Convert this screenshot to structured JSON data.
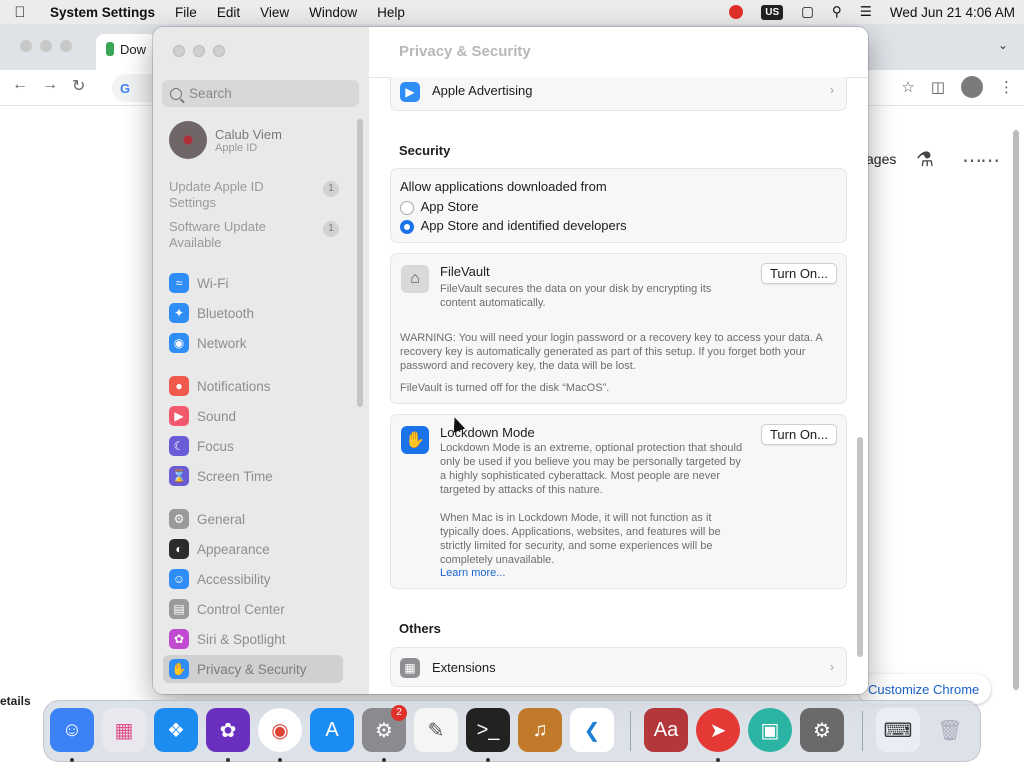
{
  "menubar": {
    "app_name": "System Settings",
    "menus": [
      "File",
      "Edit",
      "View",
      "Window",
      "Help"
    ],
    "input_source": "US",
    "datetime": "Wed Jun 21  4:06 AM"
  },
  "chrome": {
    "tab_title": "Dow",
    "images_link": "ages",
    "customize_button": "Customize Chrome",
    "left_strip_text": "etails"
  },
  "settings": {
    "search_placeholder": "Search",
    "profile": {
      "name": "Calub Viem",
      "subtitle": "Apple ID"
    },
    "updates": [
      {
        "label": "Update Apple ID Settings",
        "count": "1"
      },
      {
        "label": "Software Update Available",
        "count": "1"
      }
    ],
    "sidebar": [
      {
        "label": "Wi-Fi",
        "icon": "wifi-icon",
        "color": "#2f8ef5"
      },
      {
        "label": "Bluetooth",
        "icon": "bluetooth-icon",
        "color": "#2f8ef5"
      },
      {
        "label": "Network",
        "icon": "globe-icon",
        "color": "#2f8ef5"
      },
      {
        "label": "Notifications",
        "icon": "bell-icon",
        "color": "#f05a4c"
      },
      {
        "label": "Sound",
        "icon": "speaker-icon",
        "color": "#f05a6c"
      },
      {
        "label": "Focus",
        "icon": "moon-icon",
        "color": "#6a5cd6"
      },
      {
        "label": "Screen Time",
        "icon": "hourglass-icon",
        "color": "#6a5cd6"
      },
      {
        "label": "General",
        "icon": "gear-icon",
        "color": "#9a9a9a"
      },
      {
        "label": "Appearance",
        "icon": "appearance-icon",
        "color": "#2c2c2c"
      },
      {
        "label": "Accessibility",
        "icon": "accessibility-icon",
        "color": "#2f8ef5"
      },
      {
        "label": "Control Center",
        "icon": "control-center-icon",
        "color": "#9a9a9a"
      },
      {
        "label": "Siri & Spotlight",
        "icon": "siri-icon",
        "color": "#c04ad0"
      },
      {
        "label": "Privacy & Security",
        "icon": "hand-icon",
        "color": "#2f8ef5"
      }
    ],
    "title": "Privacy & Security",
    "apple_advertising": "Apple Advertising",
    "security_label": "Security",
    "allow_apps_label": "Allow applications downloaded from",
    "radio_options": [
      "App Store",
      "App Store and identified developers"
    ],
    "filevault": {
      "title": "FileVault",
      "description": "FileVault secures the data on your disk by encrypting its content automatically.",
      "button": "Turn On...",
      "warning": "WARNING: You will need your login password or a recovery key to access your data. A recovery key is automatically generated as part of this setup. If you forget both your password and recovery key, the data will be lost.",
      "status": "FileVault is turned off for the disk “MacOS”."
    },
    "lockdown": {
      "title": "Lockdown Mode",
      "description": "Lockdown Mode is an extreme, optional protection that should only be used if you believe you may be personally targeted by a highly sophisticated cyberattack. Most people are never targeted by attacks of this nature.",
      "description2": "When Mac is in Lockdown Mode, it will not function as it typically does. Applications, websites, and features will be strictly limited for security, and some experiences will be completely unavailable.",
      "learn_more": "Learn more...",
      "button": "Turn On..."
    },
    "others_label": "Others",
    "extensions": "Extensions"
  },
  "dock": {
    "settings_badge": "2",
    "dictionary_label": "Aa"
  }
}
